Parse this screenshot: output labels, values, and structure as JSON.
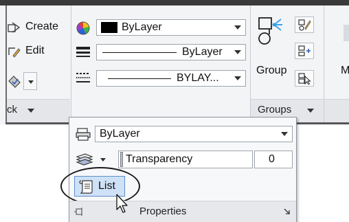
{
  "ribbon": {
    "block_panel": {
      "create_label": "Create",
      "edit_label": "Edit",
      "footer_label": "ck"
    },
    "properties_panel": {
      "color_value": "ByLayer",
      "lineweight_value": "ByLayer",
      "linetype_value": "BYLAY..."
    },
    "groups_panel": {
      "group_label": "Group",
      "footer_label": "Groups"
    },
    "next_panel_label": "M"
  },
  "expanded_panel": {
    "plot_style_value": "ByLayer",
    "transparency_label": "Transparency",
    "transparency_value": "0",
    "list_label": "List",
    "footer_label": "Properties"
  },
  "colors": {
    "ribbon_bg": "#f3f4f6",
    "highlight_button": "#cfe1f7",
    "highlight_border": "#5d8ec9"
  }
}
